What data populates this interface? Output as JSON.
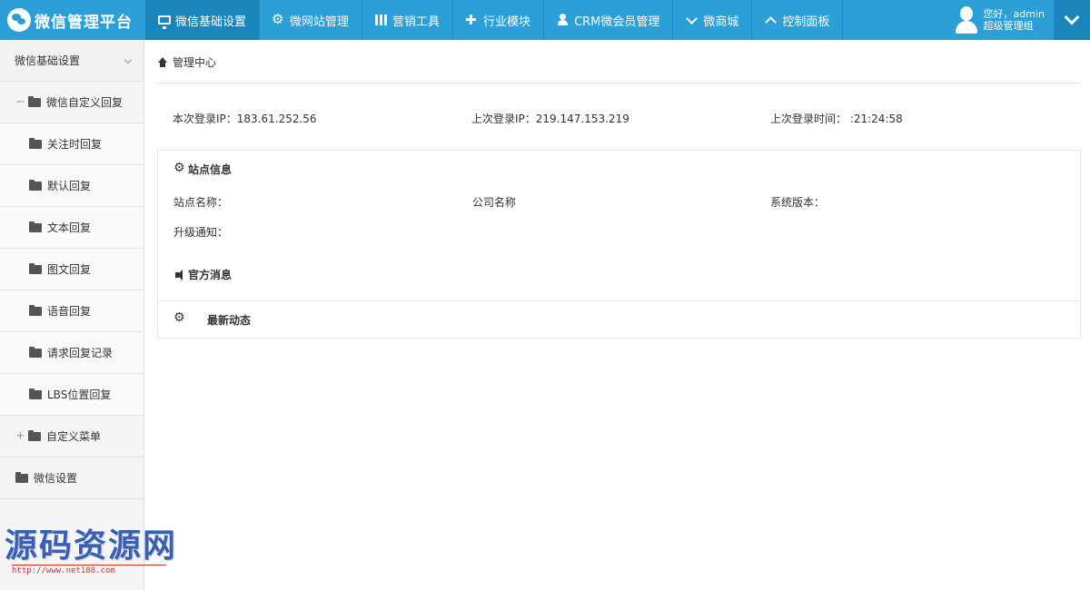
{
  "brand": {
    "title": "微信管理平台"
  },
  "nav": [
    {
      "label": "微信基础设置",
      "icon": "monitor-icon"
    },
    {
      "label": "微网站管理",
      "icon": "gear-icon"
    },
    {
      "label": "营销工具",
      "icon": "grid-icon"
    },
    {
      "label": "行业模块",
      "icon": "puzzle-icon"
    },
    {
      "label": "CRM微会员管理",
      "icon": "user-icon"
    },
    {
      "label": "微商城",
      "icon": "chevron-down-icon"
    },
    {
      "label": "控制面板",
      "icon": "chevron-up-icon"
    }
  ],
  "user": {
    "greeting": "您好，admin",
    "role": "超级管理组"
  },
  "sidebar": {
    "header": "微信基础设置",
    "group": "微信自定义回复",
    "children": [
      "关注时回复",
      "默认回复",
      "文本回复",
      "图文回复",
      "语音回复",
      "请求回复记录",
      "LBS位置回复"
    ],
    "menu": "自定义菜单",
    "settings": "微信设置"
  },
  "breadcrumb": {
    "label": "管理中心"
  },
  "login": {
    "current_ip": "本次登录IP：183.61.252.56",
    "last_ip": "上次登录IP：219.147.153.219",
    "last_time": "上次登录时间：         :21:24:58"
  },
  "site_info": {
    "title": "站点信息",
    "site_name": "站点名称：",
    "company": "公司名称",
    "version": "系统版本：",
    "upgrade": "升级通知：",
    "official": "官方消息"
  },
  "latest": {
    "title": "最新动态"
  },
  "watermark": {
    "text": "源码资源网",
    "url": "http://www.net188.com"
  }
}
